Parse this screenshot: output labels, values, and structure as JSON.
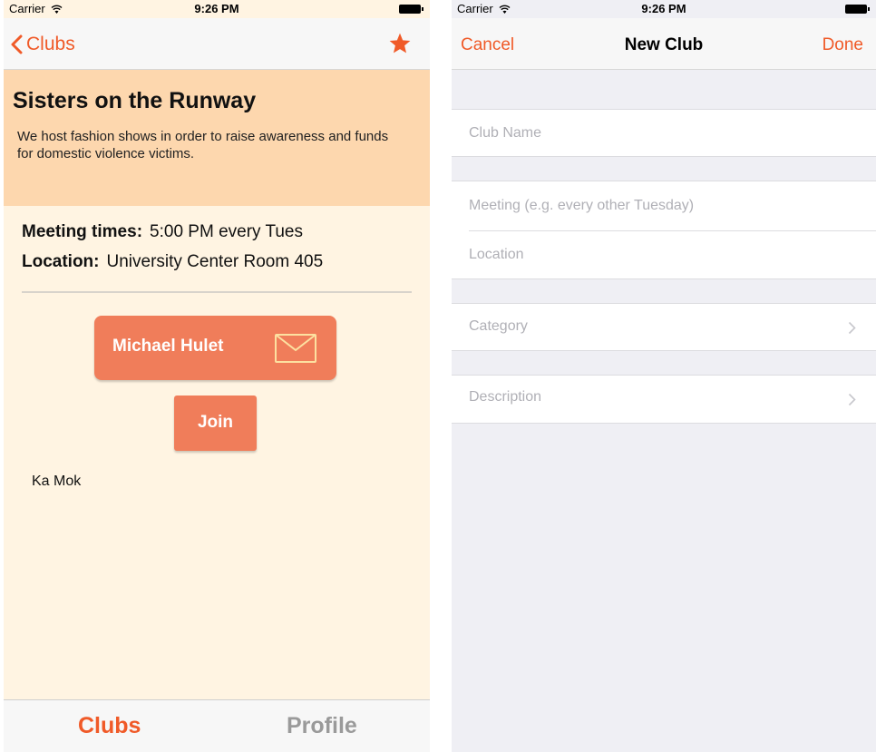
{
  "left": {
    "status": {
      "carrier": "Carrier",
      "time": "9:26 PM"
    },
    "nav": {
      "back_label": "Clubs"
    },
    "club": {
      "title": "Sisters on the Runway",
      "description": "We host fashion shows in order to raise awareness and funds for domestic violence victims.",
      "meeting_label": "Meeting times:",
      "meeting_value": "5:00 PM every Tues",
      "location_label": "Location:",
      "location_value": "University Center Room 405",
      "contact_name": "Michael Hulet",
      "join_label": "Join",
      "members": [
        "Ka Mok"
      ]
    },
    "tabs": [
      {
        "label": "Clubs",
        "active": true
      },
      {
        "label": "Profile",
        "active": false
      }
    ],
    "colors": {
      "accent": "#f05a28",
      "header_bg": "#fdd7ae",
      "body_bg": "#fff4e2",
      "button": "#f07d5a"
    }
  },
  "right": {
    "status": {
      "carrier": "Carrier",
      "time": "9:26 PM"
    },
    "nav": {
      "cancel_label": "Cancel",
      "title": "New Club",
      "done_label": "Done"
    },
    "form": {
      "club_name_placeholder": "Club Name",
      "meeting_placeholder": "Meeting (e.g. every other Tuesday)",
      "location_placeholder": "Location",
      "category_label": "Category",
      "description_label": "Description"
    }
  }
}
